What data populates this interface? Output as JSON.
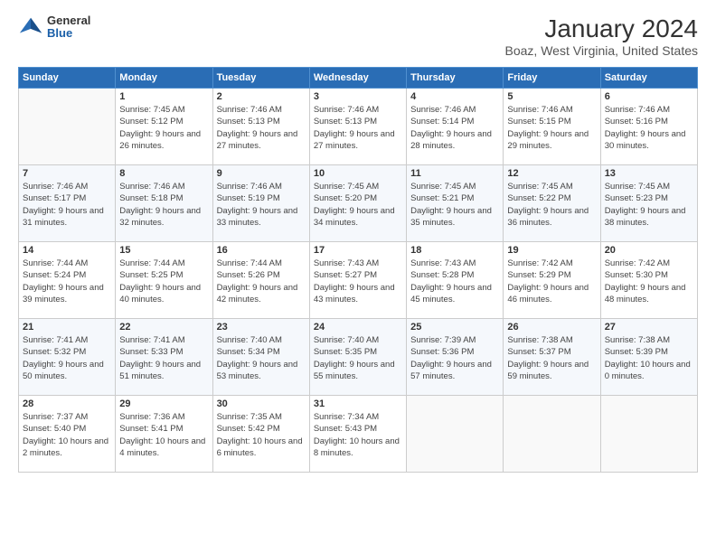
{
  "logo": {
    "line1": "General",
    "line2": "Blue"
  },
  "title": "January 2024",
  "subtitle": "Boaz, West Virginia, United States",
  "days_header": [
    "Sunday",
    "Monday",
    "Tuesday",
    "Wednesday",
    "Thursday",
    "Friday",
    "Saturday"
  ],
  "weeks": [
    [
      {
        "day": "",
        "sunrise": "",
        "sunset": "",
        "daylight": ""
      },
      {
        "day": "1",
        "sunrise": "Sunrise: 7:45 AM",
        "sunset": "Sunset: 5:12 PM",
        "daylight": "Daylight: 9 hours and 26 minutes."
      },
      {
        "day": "2",
        "sunrise": "Sunrise: 7:46 AM",
        "sunset": "Sunset: 5:13 PM",
        "daylight": "Daylight: 9 hours and 27 minutes."
      },
      {
        "day": "3",
        "sunrise": "Sunrise: 7:46 AM",
        "sunset": "Sunset: 5:13 PM",
        "daylight": "Daylight: 9 hours and 27 minutes."
      },
      {
        "day": "4",
        "sunrise": "Sunrise: 7:46 AM",
        "sunset": "Sunset: 5:14 PM",
        "daylight": "Daylight: 9 hours and 28 minutes."
      },
      {
        "day": "5",
        "sunrise": "Sunrise: 7:46 AM",
        "sunset": "Sunset: 5:15 PM",
        "daylight": "Daylight: 9 hours and 29 minutes."
      },
      {
        "day": "6",
        "sunrise": "Sunrise: 7:46 AM",
        "sunset": "Sunset: 5:16 PM",
        "daylight": "Daylight: 9 hours and 30 minutes."
      }
    ],
    [
      {
        "day": "7",
        "sunrise": "Sunrise: 7:46 AM",
        "sunset": "Sunset: 5:17 PM",
        "daylight": "Daylight: 9 hours and 31 minutes."
      },
      {
        "day": "8",
        "sunrise": "Sunrise: 7:46 AM",
        "sunset": "Sunset: 5:18 PM",
        "daylight": "Daylight: 9 hours and 32 minutes."
      },
      {
        "day": "9",
        "sunrise": "Sunrise: 7:46 AM",
        "sunset": "Sunset: 5:19 PM",
        "daylight": "Daylight: 9 hours and 33 minutes."
      },
      {
        "day": "10",
        "sunrise": "Sunrise: 7:45 AM",
        "sunset": "Sunset: 5:20 PM",
        "daylight": "Daylight: 9 hours and 34 minutes."
      },
      {
        "day": "11",
        "sunrise": "Sunrise: 7:45 AM",
        "sunset": "Sunset: 5:21 PM",
        "daylight": "Daylight: 9 hours and 35 minutes."
      },
      {
        "day": "12",
        "sunrise": "Sunrise: 7:45 AM",
        "sunset": "Sunset: 5:22 PM",
        "daylight": "Daylight: 9 hours and 36 minutes."
      },
      {
        "day": "13",
        "sunrise": "Sunrise: 7:45 AM",
        "sunset": "Sunset: 5:23 PM",
        "daylight": "Daylight: 9 hours and 38 minutes."
      }
    ],
    [
      {
        "day": "14",
        "sunrise": "Sunrise: 7:44 AM",
        "sunset": "Sunset: 5:24 PM",
        "daylight": "Daylight: 9 hours and 39 minutes."
      },
      {
        "day": "15",
        "sunrise": "Sunrise: 7:44 AM",
        "sunset": "Sunset: 5:25 PM",
        "daylight": "Daylight: 9 hours and 40 minutes."
      },
      {
        "day": "16",
        "sunrise": "Sunrise: 7:44 AM",
        "sunset": "Sunset: 5:26 PM",
        "daylight": "Daylight: 9 hours and 42 minutes."
      },
      {
        "day": "17",
        "sunrise": "Sunrise: 7:43 AM",
        "sunset": "Sunset: 5:27 PM",
        "daylight": "Daylight: 9 hours and 43 minutes."
      },
      {
        "day": "18",
        "sunrise": "Sunrise: 7:43 AM",
        "sunset": "Sunset: 5:28 PM",
        "daylight": "Daylight: 9 hours and 45 minutes."
      },
      {
        "day": "19",
        "sunrise": "Sunrise: 7:42 AM",
        "sunset": "Sunset: 5:29 PM",
        "daylight": "Daylight: 9 hours and 46 minutes."
      },
      {
        "day": "20",
        "sunrise": "Sunrise: 7:42 AM",
        "sunset": "Sunset: 5:30 PM",
        "daylight": "Daylight: 9 hours and 48 minutes."
      }
    ],
    [
      {
        "day": "21",
        "sunrise": "Sunrise: 7:41 AM",
        "sunset": "Sunset: 5:32 PM",
        "daylight": "Daylight: 9 hours and 50 minutes."
      },
      {
        "day": "22",
        "sunrise": "Sunrise: 7:41 AM",
        "sunset": "Sunset: 5:33 PM",
        "daylight": "Daylight: 9 hours and 51 minutes."
      },
      {
        "day": "23",
        "sunrise": "Sunrise: 7:40 AM",
        "sunset": "Sunset: 5:34 PM",
        "daylight": "Daylight: 9 hours and 53 minutes."
      },
      {
        "day": "24",
        "sunrise": "Sunrise: 7:40 AM",
        "sunset": "Sunset: 5:35 PM",
        "daylight": "Daylight: 9 hours and 55 minutes."
      },
      {
        "day": "25",
        "sunrise": "Sunrise: 7:39 AM",
        "sunset": "Sunset: 5:36 PM",
        "daylight": "Daylight: 9 hours and 57 minutes."
      },
      {
        "day": "26",
        "sunrise": "Sunrise: 7:38 AM",
        "sunset": "Sunset: 5:37 PM",
        "daylight": "Daylight: 9 hours and 59 minutes."
      },
      {
        "day": "27",
        "sunrise": "Sunrise: 7:38 AM",
        "sunset": "Sunset: 5:39 PM",
        "daylight": "Daylight: 10 hours and 0 minutes."
      }
    ],
    [
      {
        "day": "28",
        "sunrise": "Sunrise: 7:37 AM",
        "sunset": "Sunset: 5:40 PM",
        "daylight": "Daylight: 10 hours and 2 minutes."
      },
      {
        "day": "29",
        "sunrise": "Sunrise: 7:36 AM",
        "sunset": "Sunset: 5:41 PM",
        "daylight": "Daylight: 10 hours and 4 minutes."
      },
      {
        "day": "30",
        "sunrise": "Sunrise: 7:35 AM",
        "sunset": "Sunset: 5:42 PM",
        "daylight": "Daylight: 10 hours and 6 minutes."
      },
      {
        "day": "31",
        "sunrise": "Sunrise: 7:34 AM",
        "sunset": "Sunset: 5:43 PM",
        "daylight": "Daylight: 10 hours and 8 minutes."
      },
      {
        "day": "",
        "sunrise": "",
        "sunset": "",
        "daylight": ""
      },
      {
        "day": "",
        "sunrise": "",
        "sunset": "",
        "daylight": ""
      },
      {
        "day": "",
        "sunrise": "",
        "sunset": "",
        "daylight": ""
      }
    ]
  ]
}
